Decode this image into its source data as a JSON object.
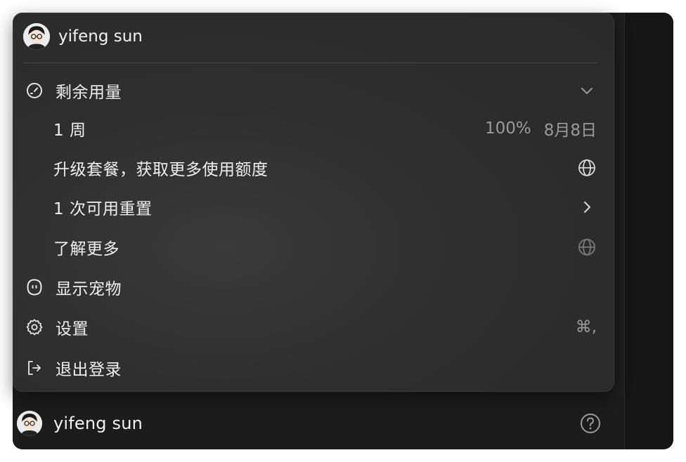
{
  "user": {
    "name": "yifeng sun"
  },
  "menu": {
    "usage": {
      "label": "剩余用量",
      "icon": "gauge-icon"
    },
    "week": {
      "label": "1 周",
      "percent": "100%",
      "reset_date": "8月8日"
    },
    "upgrade": {
      "label": "升级套餐，获取更多使用额度",
      "icon": "globe-icon"
    },
    "resets": {
      "label": "1 次可用重置",
      "icon": "chevron-right-icon"
    },
    "learn_more": {
      "label": "了解更多",
      "icon": "globe-icon"
    },
    "show_pet": {
      "label": "显示宠物",
      "icon": "pet-icon"
    },
    "settings": {
      "label": "设置",
      "icon": "gear-icon",
      "shortcut": "⌘,"
    },
    "logout": {
      "label": "退出登录",
      "icon": "logout-icon"
    }
  },
  "footer": {
    "name": "yifeng sun",
    "help_icon": "help-icon"
  },
  "colors": {
    "menu_bg": "#2e2e2e",
    "window_bg": "#1e1e1e",
    "text": "#f0f0f0",
    "muted": "#9a9a9a"
  }
}
